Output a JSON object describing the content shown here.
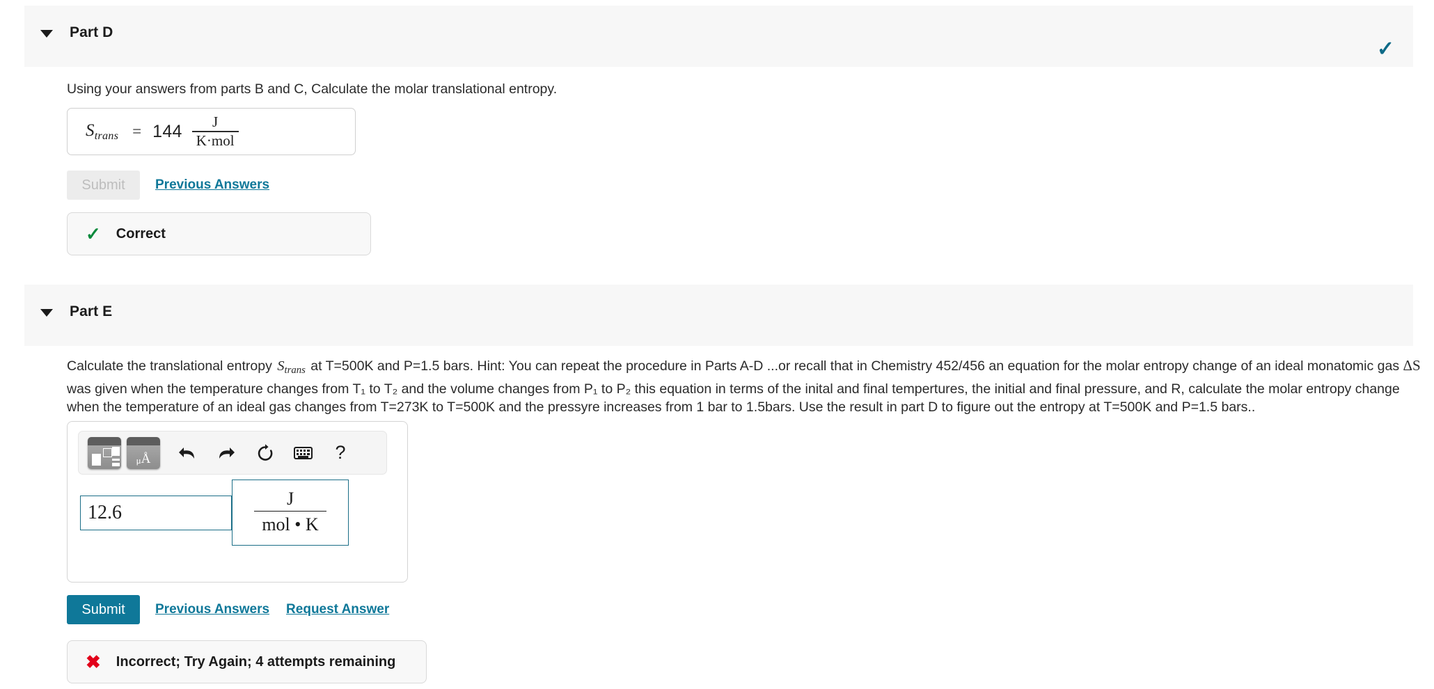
{
  "partD": {
    "title": "Part D",
    "caret_icon": "caret-down-icon",
    "status_check_icon": "check-icon",
    "prompt": "Using your answers from parts B and C, Calculate the molar translational entropy.",
    "answer": {
      "symbol": "S",
      "symbol_sub": "trans",
      "equals": "=",
      "value": "144",
      "unit_numerator": "J",
      "unit_denominator": "K·mol"
    },
    "submit_label": "Submit",
    "previous_answers_label": "Previous Answers",
    "feedback": {
      "icon": "check-icon",
      "text": "Correct"
    }
  },
  "partE": {
    "title": "Part E",
    "caret_icon": "caret-down-icon",
    "prompt_1a": "Calculate the translational entropy",
    "prompt_symbol": "S",
    "prompt_symbol_sub": "trans",
    "prompt_1b": "at T=500K and P=1.5 bars. Hint: You can repeat the procedure in Parts A-D ...or recall that in Chemistry 452/456 an equation for the molar entropy change of an ideal monatomic gas",
    "prompt_delta": "ΔS",
    "prompt_2": "was given when the temperature changes from T₁ to T₂ and the volume changes from P₁ to P₂  this equation in terms of the inital and final tempertures, the initial and final pressure, and R, calculate the molar entropy",
    "prompt_3": "change when the temperature of an ideal gas changes from T=273K to T=500K and the pressyre increases from 1 bar to 1.5bars. Use the result in part D to figure out the entropy at T=500K and P=1.5 bars..",
    "toolbar": {
      "palette_label": "math-template-palette",
      "units_label": "μÅ",
      "undo_icon": "undo-arrow-icon",
      "redo_icon": "redo-arrow-icon",
      "reset_icon": "reset-circular-arrow-icon",
      "keyboard_icon": "keyboard-icon",
      "help_label": "?"
    },
    "input_value": "12.6",
    "unit_numerator": "J",
    "unit_denominator": "mol • K",
    "submit_label": "Submit",
    "previous_answers_label": "Previous Answers",
    "request_answer_label": "Request Answer",
    "feedback": {
      "icon": "x-icon",
      "text": "Incorrect; Try Again; 4 attempts remaining"
    }
  },
  "colors": {
    "accent_teal": "#0f7899",
    "band_gray": "#f7f7f7",
    "correct_green": "#0a8a3c",
    "incorrect_red": "#e2001a",
    "input_border_teal": "#1b6e87"
  }
}
